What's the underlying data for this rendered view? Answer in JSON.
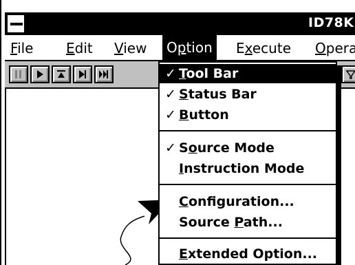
{
  "window": {
    "title": "ID78K"
  },
  "menubar": {
    "items": [
      {
        "label": "File"
      },
      {
        "label": "Edit"
      },
      {
        "label": "View"
      },
      {
        "label": "Option"
      },
      {
        "label": "Execute"
      },
      {
        "label": "Opera"
      }
    ]
  },
  "option_menu": {
    "tool_bar": "Tool Bar",
    "status_bar": "Status Bar",
    "button": "Button",
    "source_mode": "Source Mode",
    "instruction_mode": "Instruction Mode",
    "configuration": "Configuration...",
    "source_path": "Source Path...",
    "extended_option": "Extended Option...",
    "check": "✓"
  }
}
